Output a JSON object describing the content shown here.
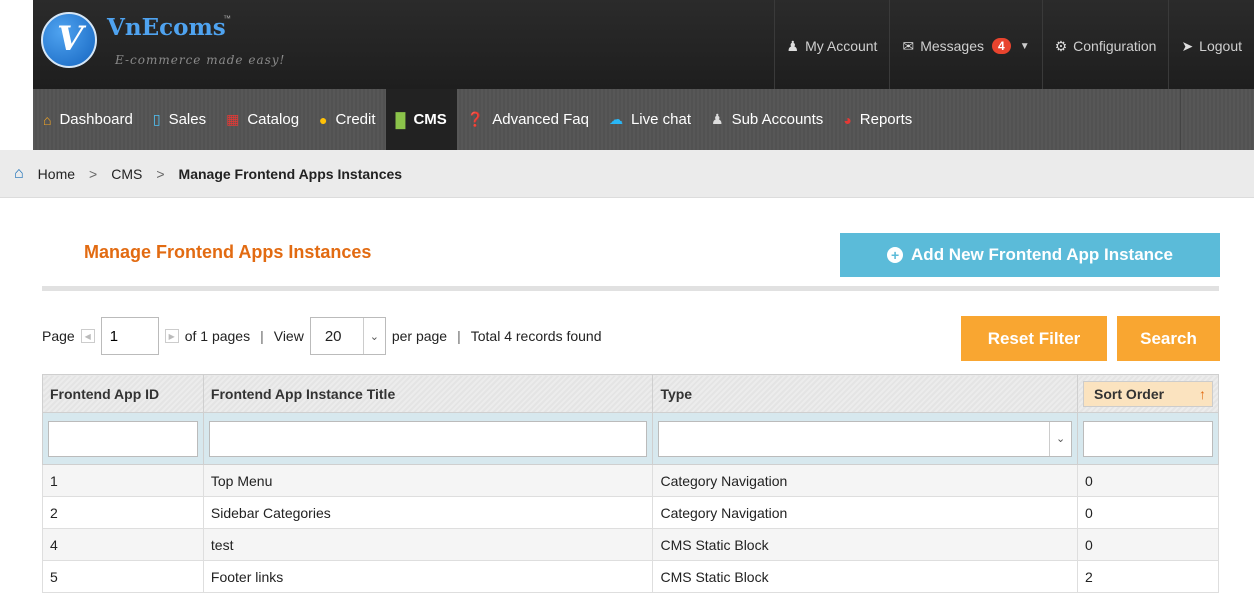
{
  "brand": {
    "name": "VnEcoms",
    "tm": "™",
    "slogan": "E-commerce made easy!"
  },
  "toplinks": [
    {
      "label": "My Account",
      "icon": "user-icon"
    },
    {
      "label": "Messages",
      "icon": "envelope-icon",
      "badge": "4"
    },
    {
      "label": "Configuration",
      "icon": "gear-icon"
    },
    {
      "label": "Logout",
      "icon": "logout-arrow-icon"
    }
  ],
  "nav": [
    {
      "label": "Dashboard",
      "icon": "home-icon",
      "color": "#f5a623"
    },
    {
      "label": "Sales",
      "icon": "bar-chart-icon",
      "color": "#4fc3f7"
    },
    {
      "label": "Catalog",
      "icon": "gift-icon",
      "color": "#e53935"
    },
    {
      "label": "Credit",
      "icon": "coin-icon",
      "color": "#ffc107"
    },
    {
      "label": "CMS",
      "icon": "book-icon",
      "color": "#8bc34a",
      "active": true
    },
    {
      "label": "Advanced Faq",
      "icon": "question-icon",
      "color": "#43a047"
    },
    {
      "label": "Live chat",
      "icon": "chat-icon",
      "color": "#29b6f6"
    },
    {
      "label": "Sub Accounts",
      "icon": "users-icon",
      "color": "#ddd"
    },
    {
      "label": "Reports",
      "icon": "pie-chart-icon",
      "color": "#e53935"
    }
  ],
  "breadcrumb": {
    "home": "Home",
    "section": "CMS",
    "current": "Manage Frontend Apps Instances"
  },
  "page": {
    "title": "Manage Frontend Apps Instances",
    "add_button": "Add New Frontend App Instance"
  },
  "pager": {
    "page_label": "Page",
    "page_value": "1",
    "of_pages": "of 1 pages",
    "view_label": "View",
    "per_page_value": "20",
    "per_page_label": "per page",
    "records": "Total 4 records found"
  },
  "actions": {
    "reset": "Reset Filter",
    "search": "Search"
  },
  "grid": {
    "columns": [
      "Frontend App ID",
      "Frontend App Instance Title",
      "Type",
      "Sort Order"
    ],
    "rows": [
      [
        "1",
        "Top Menu",
        "Category Navigation",
        "0"
      ],
      [
        "2",
        "Sidebar Categories",
        "Category Navigation",
        "0"
      ],
      [
        "4",
        "test",
        "CMS Static Block",
        "0"
      ],
      [
        "5",
        "Footer links",
        "CMS Static Block",
        "2"
      ]
    ]
  }
}
